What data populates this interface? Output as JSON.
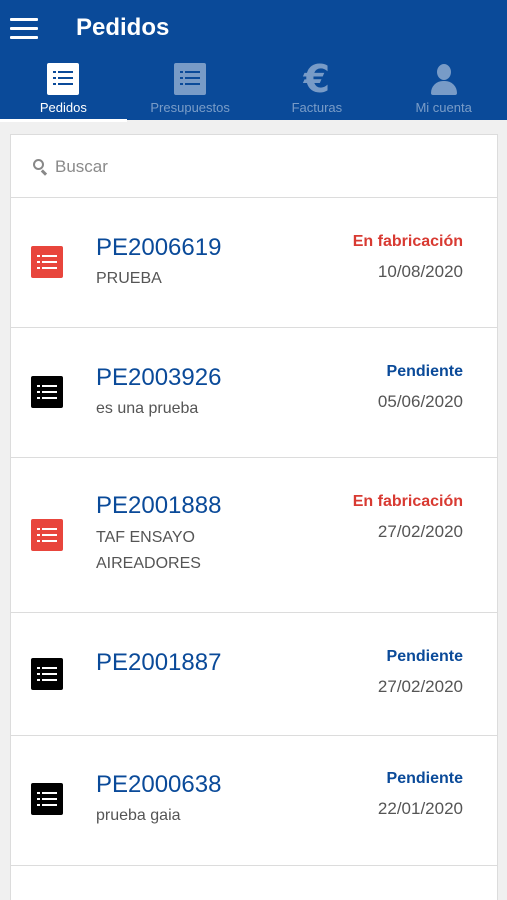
{
  "app": {
    "title": "Pedidos"
  },
  "colors": {
    "primary": "#0a4a99",
    "status_fabricacion": "#d83a32",
    "status_pendiente": "#0a4a99"
  },
  "tabs": [
    {
      "label": "Pedidos",
      "icon": "list-icon",
      "active": true
    },
    {
      "label": "Presupuestos",
      "icon": "list-icon",
      "active": false
    },
    {
      "label": "Facturas",
      "icon": "euro-icon",
      "active": false
    },
    {
      "label": "Mi cuenta",
      "icon": "person-icon",
      "active": false
    }
  ],
  "search": {
    "placeholder": "Buscar"
  },
  "orders": [
    {
      "code": "PE2006619",
      "description": "PRUEBA",
      "status": "En fabricación",
      "date": "10/08/2020",
      "icon_color": "red"
    },
    {
      "code": "PE2003926",
      "description": "es una prueba",
      "status": "Pendiente",
      "date": "05/06/2020",
      "icon_color": "black"
    },
    {
      "code": "PE2001888",
      "description": "TAF ENSAYO AIREADORES",
      "status": "En fabricación",
      "date": "27/02/2020",
      "icon_color": "red"
    },
    {
      "code": "PE2001887",
      "description": "",
      "status": "Pendiente",
      "date": "27/02/2020",
      "icon_color": "black"
    },
    {
      "code": "PE2000638",
      "description": "prueba gaia",
      "status": "Pendiente",
      "date": "22/01/2020",
      "icon_color": "black"
    }
  ]
}
